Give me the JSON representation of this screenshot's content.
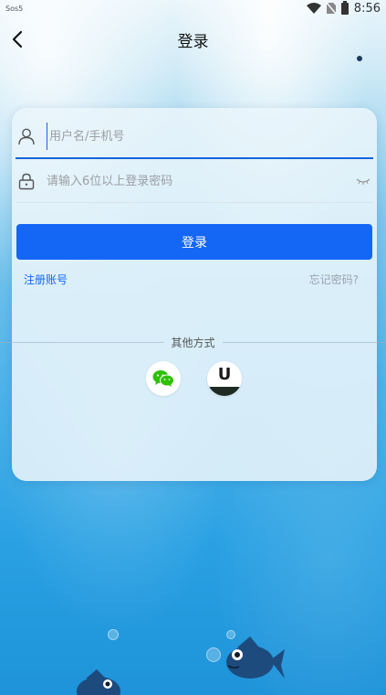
{
  "status_bar": {
    "carrier": "Sos5",
    "time": "8:56"
  },
  "nav": {
    "title": "登录"
  },
  "form": {
    "username_placeholder": "用户名/手机号",
    "username_value": "",
    "password_placeholder": "请输入6位以上登录密码",
    "password_value": "",
    "login_label": "登录",
    "register_label": "注册账号",
    "forgot_label": "忘记密码?"
  },
  "other": {
    "label": "其他方式",
    "wechat_icon": "wechat-icon",
    "u_icon": "u-app-icon"
  },
  "colors": {
    "primary": "#1466f5",
    "link": "#1466f5",
    "muted": "#9aa4ad",
    "wechat": "#2dc100"
  }
}
